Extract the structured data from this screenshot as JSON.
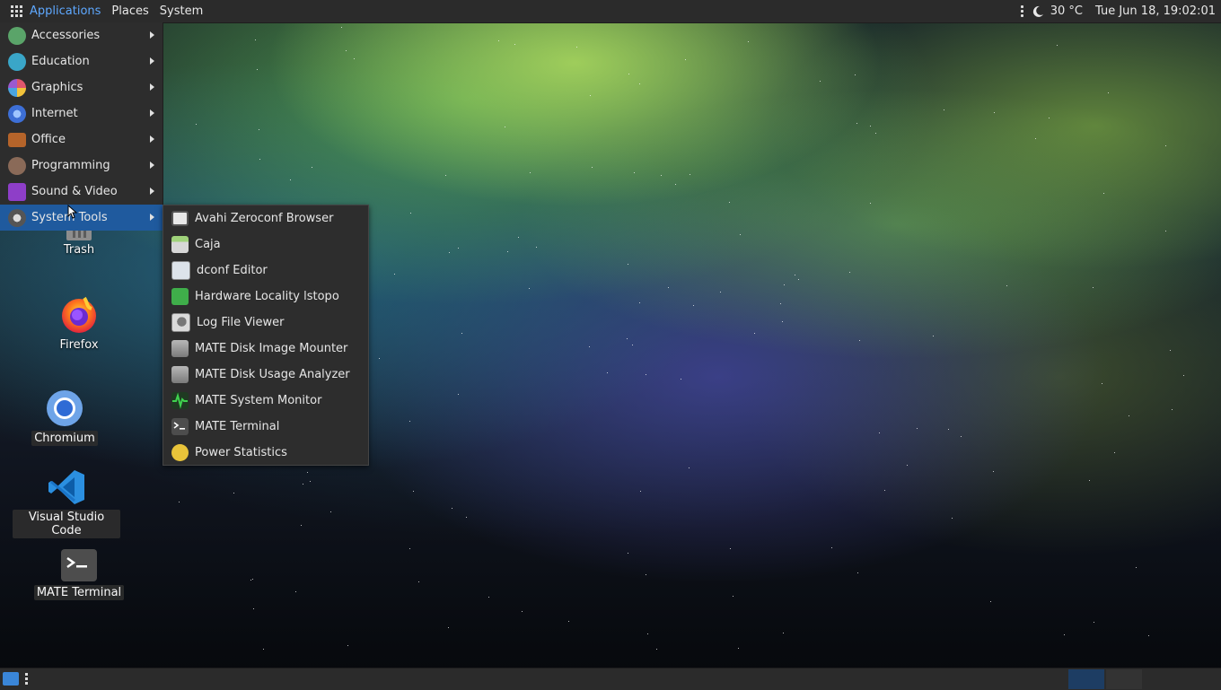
{
  "top_panel": {
    "menus": [
      "Applications",
      "Places",
      "System"
    ],
    "weather": "30 °C",
    "clock": "Tue Jun 18, 19:02:01"
  },
  "apps_menu": {
    "categories": [
      {
        "label": "Accessories",
        "icon": "accessories-icon",
        "color": "#5aa469"
      },
      {
        "label": "Education",
        "icon": "education-icon",
        "color": "#3aa6c8"
      },
      {
        "label": "Graphics",
        "icon": "graphics-icon",
        "color": "#e0566d"
      },
      {
        "label": "Internet",
        "icon": "internet-icon",
        "color": "#3d6fd6"
      },
      {
        "label": "Office",
        "icon": "office-icon",
        "color": "#b5642a"
      },
      {
        "label": "Programming",
        "icon": "programming-icon",
        "color": "#8a6a58"
      },
      {
        "label": "Sound & Video",
        "icon": "sound-video-icon",
        "color": "#8e3ec8"
      },
      {
        "label": "System Tools",
        "icon": "system-tools-icon",
        "color": "#555555"
      }
    ],
    "active": "System Tools"
  },
  "submenu": {
    "items": [
      {
        "label": "Avahi Zeroconf Browser",
        "icon": "avahi-icon",
        "color": "#cfcfcf"
      },
      {
        "label": "Caja",
        "icon": "caja-icon",
        "color": "#9fd27a"
      },
      {
        "label": "dconf Editor",
        "icon": "dconf-icon",
        "color": "#dde3ea"
      },
      {
        "label": "Hardware Locality lstopo",
        "icon": "lstopo-icon",
        "color": "#3fae4a"
      },
      {
        "label": "Log File Viewer",
        "icon": "log-viewer-icon",
        "color": "#c8c8c8"
      },
      {
        "label": "MATE Disk Image Mounter",
        "icon": "disk-mounter-icon",
        "color": "#9a9a9a"
      },
      {
        "label": "MATE Disk Usage Analyzer",
        "icon": "disk-usage-icon",
        "color": "#9a9a9a"
      },
      {
        "label": "MATE System Monitor",
        "icon": "system-monitor-icon",
        "color": "#2b8c3a"
      },
      {
        "label": "MATE Terminal",
        "icon": "terminal-icon",
        "color": "#444444"
      },
      {
        "label": "Power Statistics",
        "icon": "power-stats-icon",
        "color": "#e9c43a"
      }
    ]
  },
  "desktop": {
    "icons": [
      {
        "label": "Trash",
        "icon": "trash-icon"
      },
      {
        "label": "Firefox",
        "icon": "firefox-icon"
      },
      {
        "label": "Chromium",
        "icon": "chromium-icon"
      },
      {
        "label": "Visual Studio Code",
        "icon": "vscode-icon"
      },
      {
        "label": "MATE Terminal",
        "icon": "terminal-icon"
      }
    ]
  },
  "colors": {
    "panel": "#2b2b2b",
    "menu": "#2d2d2d",
    "highlight": "#1f5a9e",
    "accent_text": "#5ea8ff"
  }
}
